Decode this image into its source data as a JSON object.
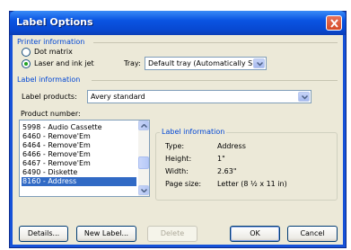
{
  "window": {
    "title": "Label Options"
  },
  "printer_info": {
    "group_title": "Printer information",
    "dot_matrix": {
      "label": "Dot matrix",
      "selected": false
    },
    "laser_inkjet": {
      "label": "Laser and ink jet",
      "selected": true
    },
    "tray": {
      "label": "Tray:",
      "value": "Default tray (Automatically Sele"
    }
  },
  "label_info": {
    "group_title": "Label information",
    "label_products": {
      "label": "Label products:",
      "value": "Avery standard"
    },
    "product_number": {
      "label": "Product number:",
      "items": [
        "5998 - Audio Cassette",
        "6460 - Remove'Em",
        "6464 - Remove'Em",
        "6466 - Remove'Em",
        "6467 - Remove'Em",
        "6490 - Diskette",
        "8160 - Address"
      ],
      "selected_index": 6
    },
    "details": {
      "title": "Label information",
      "type_label": "Type:",
      "type_value": "Address",
      "height_label": "Height:",
      "height_value": "1\"",
      "width_label": "Width:",
      "width_value": "2.63\"",
      "pagesize_label": "Page size:",
      "pagesize_value": "Letter (8 ½ x 11 in)"
    }
  },
  "buttons": {
    "details": "Details...",
    "new_label": "New Label...",
    "delete": "Delete",
    "ok": "OK",
    "cancel": "Cancel"
  }
}
